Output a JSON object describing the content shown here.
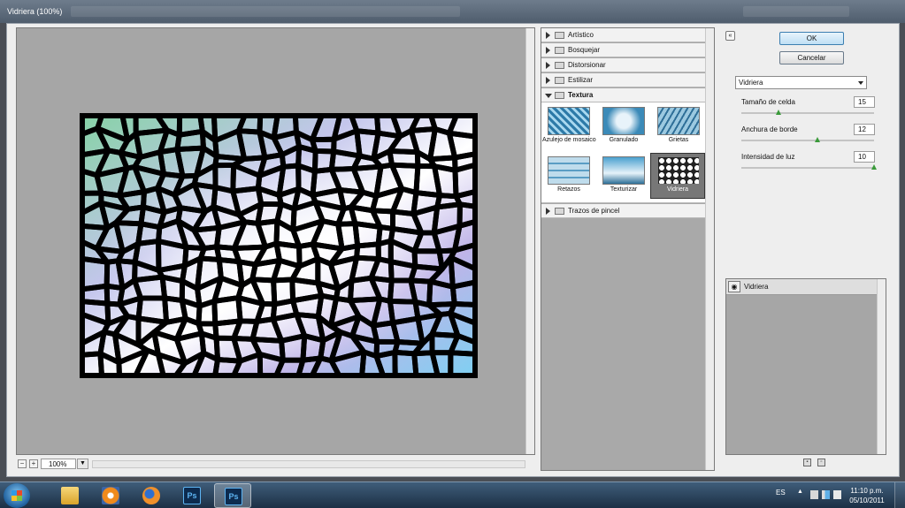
{
  "window": {
    "title": "Vidriera (100%)"
  },
  "preview": {
    "zoom": "100%",
    "zoom_out_symbol": "−",
    "zoom_in_symbol": "+"
  },
  "gallery": {
    "categories": [
      {
        "label": "Artístico",
        "expanded": false
      },
      {
        "label": "Bosquejar",
        "expanded": false
      },
      {
        "label": "Distorsionar",
        "expanded": false
      },
      {
        "label": "Estilizar",
        "expanded": false
      },
      {
        "label": "Textura",
        "expanded": true
      },
      {
        "label": "Trazos de pincel",
        "expanded": false
      }
    ],
    "textura_filters": [
      {
        "label": "Azulejo de mosaico",
        "selected": false
      },
      {
        "label": "Granulado",
        "selected": false
      },
      {
        "label": "Grietas",
        "selected": false
      },
      {
        "label": "Retazos",
        "selected": false
      },
      {
        "label": "Texturizar",
        "selected": false
      },
      {
        "label": "Vidriera",
        "selected": true
      }
    ]
  },
  "controls": {
    "collapse_symbol": "«",
    "ok_label": "OK",
    "cancel_label": "Cancelar",
    "filter_select": "Vidriera",
    "params": [
      {
        "label": "Tamaño de celda",
        "value": "15",
        "fraction": 0.28
      },
      {
        "label": "Anchura de borde",
        "value": "12",
        "fraction": 0.57
      },
      {
        "label": "Intensidad de luz",
        "value": "10",
        "fraction": 1.0
      }
    ]
  },
  "layers": {
    "items": [
      {
        "label": "Vidriera",
        "visible": true
      }
    ]
  },
  "taskbar": {
    "apps": [
      {
        "name": "explorer-folder",
        "active": false
      },
      {
        "name": "media-player",
        "active": false
      },
      {
        "name": "firefox",
        "active": false
      },
      {
        "name": "photoshop",
        "label": "Ps",
        "active": false
      },
      {
        "name": "photoshop",
        "label": "Ps",
        "active": true
      }
    ],
    "language": "ES",
    "tray_arrow": "▲",
    "time": "11:10 p.m.",
    "date": "05/10/2011"
  },
  "colors": {
    "accent": "#3c7fb1",
    "slider_knob": "#3a9a3a",
    "dialog_bg": "#eeeeee",
    "preview_bg": "#a6a6a6"
  }
}
